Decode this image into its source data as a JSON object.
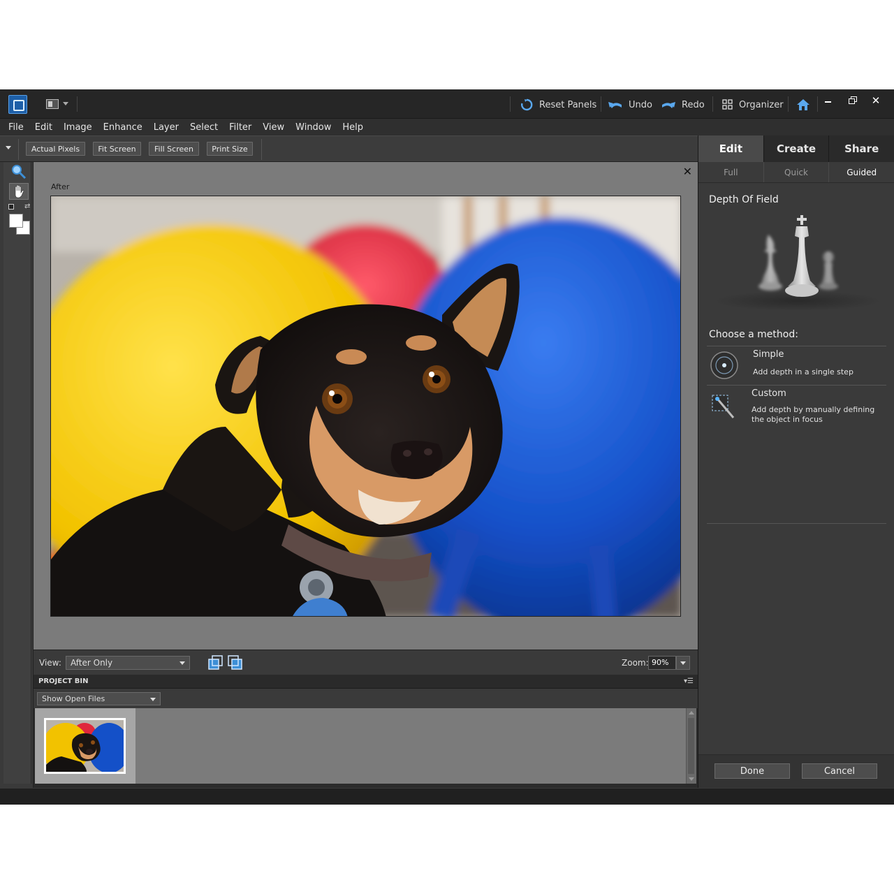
{
  "titlebar": {
    "reset_panels": "Reset Panels",
    "undo": "Undo",
    "redo": "Redo",
    "organizer": "Organizer"
  },
  "menu": [
    "File",
    "Edit",
    "Image",
    "Enhance",
    "Layer",
    "Select",
    "Filter",
    "View",
    "Window",
    "Help"
  ],
  "options_bar": {
    "actual_pixels": "Actual Pixels",
    "fit_screen": "Fit Screen",
    "fill_screen": "Fill Screen",
    "print_size": "Print Size"
  },
  "canvas": {
    "label": "After",
    "close_glyph": "✕"
  },
  "view_bar": {
    "view_label": "View:",
    "view_value": "After Only",
    "zoom_label": "Zoom:",
    "zoom_value": "90%"
  },
  "project_bin": {
    "title": "PROJECT BIN",
    "filter_value": "Show Open Files"
  },
  "panel": {
    "tabs": [
      "Edit",
      "Create",
      "Share"
    ],
    "active_tab": "Edit",
    "subtabs": [
      "Full",
      "Quick",
      "Guided"
    ],
    "active_subtab": "Guided",
    "title": "Depth Of Field",
    "method_heading": "Choose a method:",
    "methods": [
      {
        "name": "Simple",
        "description": "Add depth in a single step"
      },
      {
        "name": "Custom",
        "description": "Add depth by manually defining the object in focus"
      }
    ],
    "done": "Done",
    "cancel": "Cancel"
  },
  "colors": {
    "accent_blue": "#3d8fd6",
    "panel_bg": "#3a3a3a",
    "canvas_bg": "#7b7b7b"
  }
}
